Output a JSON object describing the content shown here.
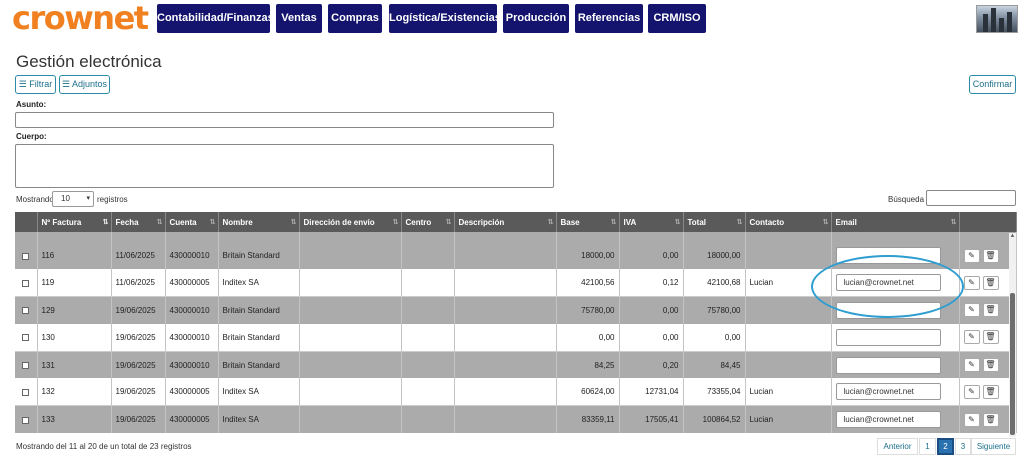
{
  "app": {
    "logo": "crownet"
  },
  "nav": [
    "Contabilidad/Finanzas",
    "Ventas",
    "Compras",
    "Logística/Existencias",
    "Producción",
    "Referencias",
    "CRM/ISO"
  ],
  "page": {
    "title": "Gestión electrónica"
  },
  "toolbar": {
    "filter_label": "☰ Filtrar",
    "attachments_label": "☰ Adjuntos",
    "confirm_label": "Confirmar"
  },
  "form": {
    "subject_label": "Asunto:",
    "body_label": "Cuerpo:"
  },
  "list_controls": {
    "showing_prefix": "Mostrando",
    "page_size": "10",
    "showing_suffix": "registros",
    "search_label": "Búsqueda"
  },
  "table": {
    "headers": [
      "",
      "Nº Factura",
      "Fecha",
      "Cuenta",
      "Nombre",
      "Dirección de envío",
      "Centro",
      "Descripción",
      "Base",
      "IVA",
      "Total",
      "Contacto",
      "Email",
      ""
    ],
    "rows": [
      {
        "factura": "116",
        "fecha": "11/06/2025",
        "cuenta": "430000010",
        "nombre": "Britain Standard",
        "base": "18000,00",
        "iva": "0,00",
        "total": "18000,00",
        "contacto": "",
        "email": ""
      },
      {
        "factura": "119",
        "fecha": "11/06/2025",
        "cuenta": "430000005",
        "nombre": "Inditex SA",
        "base": "42100,56",
        "iva": "0,12",
        "total": "42100,68",
        "contacto": "Lucian",
        "email": "lucian@crownet.net"
      },
      {
        "factura": "129",
        "fecha": "19/06/2025",
        "cuenta": "430000010",
        "nombre": "Britain Standard",
        "base": "75780,00",
        "iva": "0,00",
        "total": "75780,00",
        "contacto": "",
        "email": ""
      },
      {
        "factura": "130",
        "fecha": "19/06/2025",
        "cuenta": "430000010",
        "nombre": "Britain Standard",
        "base": "0,00",
        "iva": "0,00",
        "total": "0,00",
        "contacto": "",
        "email": ""
      },
      {
        "factura": "131",
        "fecha": "19/06/2025",
        "cuenta": "430000010",
        "nombre": "Britain Standard",
        "base": "84,25",
        "iva": "0,20",
        "total": "84,45",
        "contacto": "",
        "email": ""
      },
      {
        "factura": "132",
        "fecha": "19/06/2025",
        "cuenta": "430000005",
        "nombre": "Inditex SA",
        "base": "60624,00",
        "iva": "12731,04",
        "total": "73355,04",
        "contacto": "Lucian",
        "email": "lucian@crownet.net"
      },
      {
        "factura": "133",
        "fecha": "19/06/2025",
        "cuenta": "430000005",
        "nombre": "Inditex SA",
        "base": "83359,11",
        "iva": "17505,41",
        "total": "100864,52",
        "contacto": "Lucian",
        "email": "lucian@crownet.net"
      }
    ]
  },
  "footer": {
    "summary": "Mostrando del 11 al 20 de un total de 23 registros",
    "pagination": {
      "prev": "Anterior",
      "pages": [
        "1",
        "2",
        "3"
      ],
      "active": "2",
      "next": "Siguiente"
    }
  },
  "icons": {
    "edit": "pencil-icon",
    "delete": "trash-icon",
    "sort": "sort-icon",
    "dropdown": "chevron-down-icon"
  },
  "colors": {
    "logo": "#f08020",
    "nav_bg": "#14146e",
    "header_bg": "#5a5a5a",
    "row_gray": "#ababab",
    "accent": "#2a8aa8",
    "highlight": "#2e9dd0"
  }
}
